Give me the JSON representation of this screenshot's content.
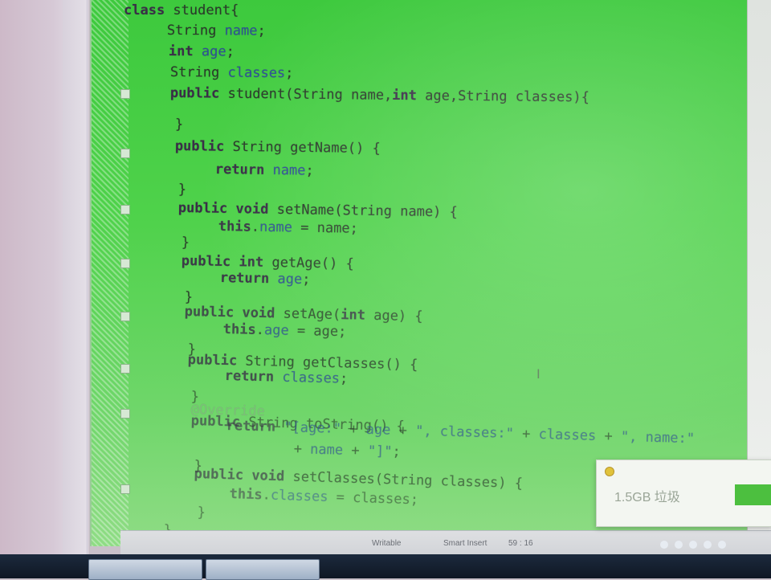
{
  "editor": {
    "lines": [
      {
        "id": "l1",
        "parts": [
          {
            "t": "kw",
            "s": "class"
          },
          {
            "t": "",
            "s": " student{"
          }
        ]
      },
      {
        "id": "l2",
        "parts": [
          {
            "t": "",
            "s": "String "
          },
          {
            "t": "fld",
            "s": "name"
          },
          {
            "t": "",
            "s": ";"
          }
        ]
      },
      {
        "id": "l3",
        "parts": [
          {
            "t": "kw",
            "s": "int"
          },
          {
            "t": "",
            "s": " "
          },
          {
            "t": "fld",
            "s": "age"
          },
          {
            "t": "",
            "s": ";"
          }
        ]
      },
      {
        "id": "l4",
        "parts": [
          {
            "t": "",
            "s": "String "
          },
          {
            "t": "fld",
            "s": "classes"
          },
          {
            "t": "",
            "s": ";"
          }
        ]
      },
      {
        "id": "l5",
        "parts": [
          {
            "t": "kw",
            "s": "public"
          },
          {
            "t": "",
            "s": " student(String name,"
          },
          {
            "t": "kw",
            "s": "int"
          },
          {
            "t": "",
            "s": " age,String classes){"
          }
        ]
      },
      {
        "id": "l6",
        "parts": [
          {
            "t": "",
            "s": "}"
          }
        ]
      },
      {
        "id": "l7",
        "parts": [
          {
            "t": "kw",
            "s": "public"
          },
          {
            "t": "",
            "s": " String getName() {"
          }
        ]
      },
      {
        "id": "l8",
        "parts": [
          {
            "t": "kw",
            "s": "return"
          },
          {
            "t": "",
            "s": " "
          },
          {
            "t": "fld",
            "s": "name"
          },
          {
            "t": "",
            "s": ";"
          }
        ]
      },
      {
        "id": "l9",
        "parts": [
          {
            "t": "",
            "s": "}"
          }
        ]
      },
      {
        "id": "l10",
        "parts": [
          {
            "t": "kw",
            "s": "public"
          },
          {
            "t": "",
            "s": " "
          },
          {
            "t": "kw",
            "s": "void"
          },
          {
            "t": "",
            "s": " setName(String name) {"
          }
        ]
      },
      {
        "id": "l11",
        "parts": [
          {
            "t": "kw",
            "s": "this"
          },
          {
            "t": "",
            "s": "."
          },
          {
            "t": "fld",
            "s": "name"
          },
          {
            "t": "",
            "s": " = name;"
          }
        ]
      },
      {
        "id": "l12",
        "parts": [
          {
            "t": "",
            "s": "}"
          }
        ]
      },
      {
        "id": "l13",
        "parts": [
          {
            "t": "kw",
            "s": "public"
          },
          {
            "t": "",
            "s": " "
          },
          {
            "t": "kw",
            "s": "int"
          },
          {
            "t": "",
            "s": " getAge() {"
          }
        ]
      },
      {
        "id": "l14",
        "parts": [
          {
            "t": "kw",
            "s": "return"
          },
          {
            "t": "",
            "s": " "
          },
          {
            "t": "fld",
            "s": "age"
          },
          {
            "t": "",
            "s": ";"
          }
        ]
      },
      {
        "id": "l15",
        "parts": [
          {
            "t": "",
            "s": "}"
          }
        ]
      },
      {
        "id": "l16",
        "parts": [
          {
            "t": "kw",
            "s": "public"
          },
          {
            "t": "",
            "s": " "
          },
          {
            "t": "kw",
            "s": "void"
          },
          {
            "t": "",
            "s": " setAge("
          },
          {
            "t": "kw",
            "s": "int"
          },
          {
            "t": "",
            "s": " age) {"
          }
        ]
      },
      {
        "id": "l17",
        "parts": [
          {
            "t": "kw",
            "s": "this"
          },
          {
            "t": "",
            "s": "."
          },
          {
            "t": "fld",
            "s": "age"
          },
          {
            "t": "",
            "s": " = age;"
          }
        ]
      },
      {
        "id": "l18",
        "parts": [
          {
            "t": "",
            "s": "}"
          }
        ]
      },
      {
        "id": "l19",
        "parts": [
          {
            "t": "kw",
            "s": "public"
          },
          {
            "t": "",
            "s": " String getClasses() {"
          }
        ]
      },
      {
        "id": "l20",
        "parts": [
          {
            "t": "kw",
            "s": "return"
          },
          {
            "t": "",
            "s": " "
          },
          {
            "t": "fld",
            "s": "classes"
          },
          {
            "t": "",
            "s": ";"
          }
        ]
      },
      {
        "id": "l21",
        "parts": [
          {
            "t": "",
            "s": "}"
          }
        ]
      },
      {
        "id": "l22",
        "parts": [
          {
            "t": "ann",
            "s": "@Override"
          }
        ]
      },
      {
        "id": "l23",
        "parts": [
          {
            "t": "kw",
            "s": "public"
          },
          {
            "t": "",
            "s": " String toString() {"
          }
        ]
      },
      {
        "id": "l24",
        "parts": [
          {
            "t": "kw",
            "s": "return"
          },
          {
            "t": "",
            "s": " "
          },
          {
            "t": "str",
            "s": "\"[age:\""
          },
          {
            "t": "",
            "s": " + "
          },
          {
            "t": "fld",
            "s": "age"
          },
          {
            "t": "",
            "s": " + "
          },
          {
            "t": "str",
            "s": "\", classes:\""
          },
          {
            "t": "",
            "s": " + "
          },
          {
            "t": "fld",
            "s": "classes"
          },
          {
            "t": "",
            "s": " + "
          },
          {
            "t": "str",
            "s": "\", name:\""
          }
        ]
      },
      {
        "id": "l25",
        "parts": [
          {
            "t": "",
            "s": "+ "
          },
          {
            "t": "fld",
            "s": "name"
          },
          {
            "t": "",
            "s": " + "
          },
          {
            "t": "str",
            "s": "\"]\""
          },
          {
            "t": "",
            "s": ";"
          }
        ]
      },
      {
        "id": "l26",
        "parts": [
          {
            "t": "",
            "s": "}"
          }
        ]
      },
      {
        "id": "l27",
        "parts": [
          {
            "t": "kw",
            "s": "public"
          },
          {
            "t": "",
            "s": " "
          },
          {
            "t": "kw",
            "s": "void"
          },
          {
            "t": "",
            "s": " setClasses(String classes) {"
          }
        ]
      },
      {
        "id": "l28",
        "parts": [
          {
            "t": "kw",
            "s": "this"
          },
          {
            "t": "",
            "s": "."
          },
          {
            "t": "fld",
            "s": "classes"
          },
          {
            "t": "",
            "s": " = classes;"
          }
        ]
      },
      {
        "id": "l29",
        "parts": [
          {
            "t": "",
            "s": "}"
          }
        ]
      },
      {
        "id": "l30",
        "parts": [
          {
            "t": "",
            "s": "}"
          }
        ]
      }
    ]
  },
  "status": {
    "mode": "Writable",
    "insert": "Smart Insert",
    "position": "59 : 16"
  },
  "popup": {
    "size": "1.5GB 垃圾"
  },
  "colors": {
    "editor_bg": "#4fd24b",
    "keyword": "#3a2e48",
    "field": "#2f4f9a",
    "popup_button": "#4cbf3f"
  }
}
